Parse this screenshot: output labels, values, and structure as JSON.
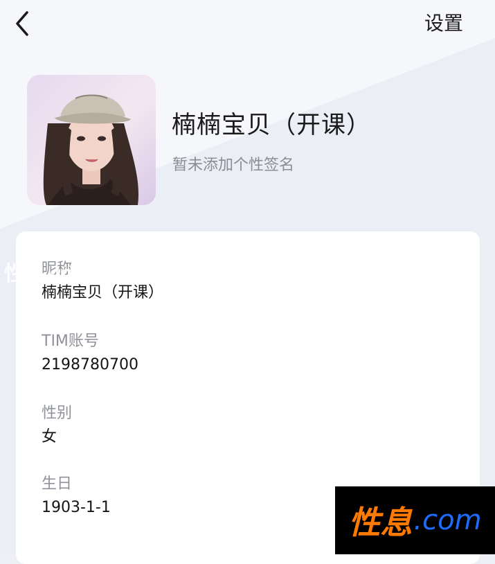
{
  "header": {
    "back_icon": "chevron-left-icon",
    "settings_label": "设置"
  },
  "profile": {
    "avatar": "avatar-photo",
    "name": "楠楠宝贝（开课）",
    "signature": "暂未添加个性签名"
  },
  "info": {
    "fields": [
      {
        "label": "昵称",
        "value": "楠楠宝贝（开课）"
      },
      {
        "label": "TIM账号",
        "value": "2198780700"
      },
      {
        "label": "性别",
        "value": "女"
      },
      {
        "label": "生日",
        "value": "1903-1-1"
      }
    ]
  },
  "watermark": {
    "left_text": "性息.com",
    "brand": "性息",
    "domain": ".com"
  },
  "colors": {
    "background": "#eef0f6",
    "card": "#ffffff",
    "label": "#8f9299",
    "text": "#151515",
    "watermark_brand": "#ff7a00",
    "watermark_domain": "#1e6bff"
  }
}
